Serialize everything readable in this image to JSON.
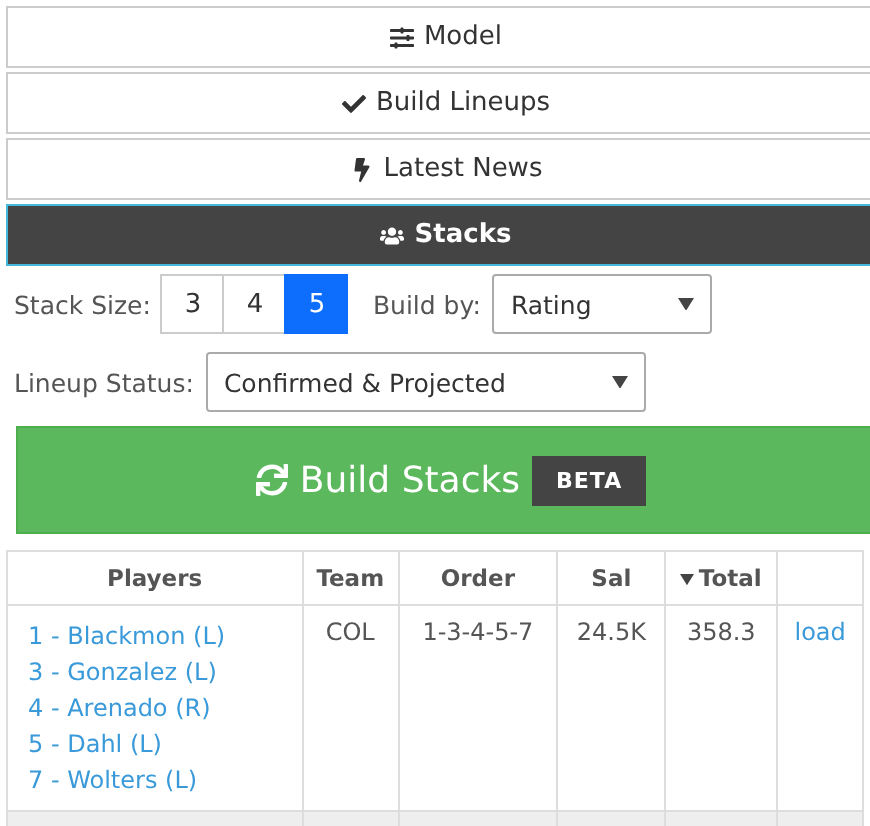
{
  "nav": [
    {
      "label": "Model",
      "selected": false
    },
    {
      "label": "Build Lineups",
      "selected": false
    },
    {
      "label": "Latest News",
      "selected": false
    },
    {
      "label": "Stacks",
      "selected": true
    }
  ],
  "stack_size": {
    "label": "Stack Size:",
    "options": [
      {
        "label": "3",
        "selected": false
      },
      {
        "label": "4",
        "selected": false
      },
      {
        "label": "5",
        "selected": true
      }
    ]
  },
  "build_by": {
    "label": "Build by:",
    "value": "Rating"
  },
  "lineup_status": {
    "label": "Lineup Status:",
    "value": "Confirmed & Projected"
  },
  "build_button": {
    "label": "Build Stacks",
    "badge": "BETA"
  },
  "table": {
    "columns": [
      {
        "label": "Players",
        "sorted": false
      },
      {
        "label": "Team",
        "sorted": false
      },
      {
        "label": "Order",
        "sorted": false
      },
      {
        "label": "Sal",
        "sorted": false
      },
      {
        "label": "Total",
        "sorted": true
      }
    ],
    "rows": [
      {
        "players": [
          "1 - Blackmon (L)",
          "3 - Gonzalez (L)",
          "4 - Arenado (R)",
          "5 - Dahl (L)",
          "7 - Wolters (L)"
        ],
        "team": "COL",
        "order": "1-3-4-5-7",
        "sal": "24.5K",
        "total": "358.3",
        "action": "load"
      }
    ]
  }
}
